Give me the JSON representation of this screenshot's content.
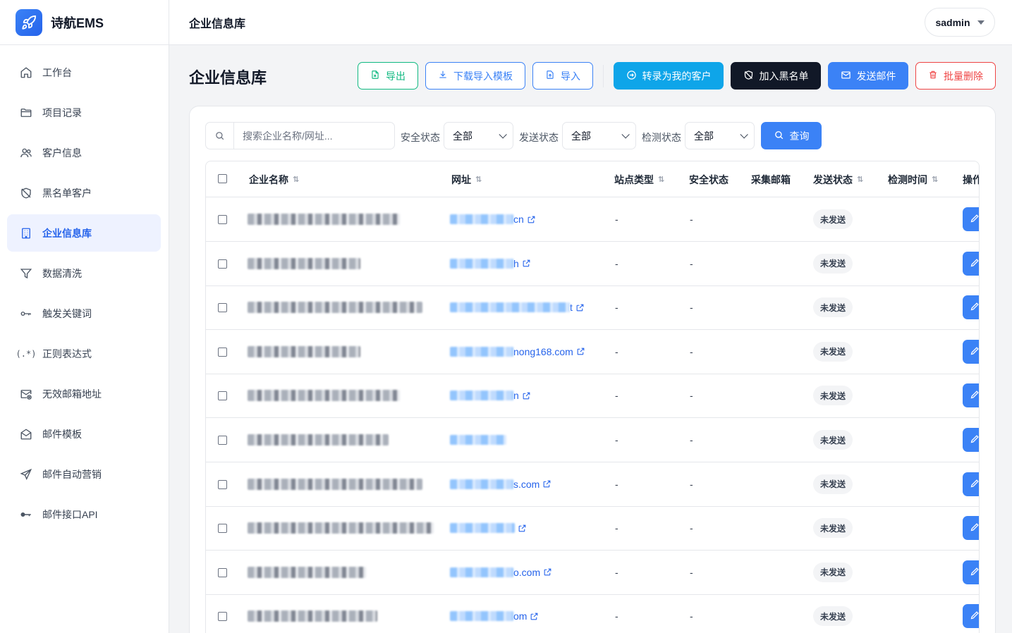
{
  "brand": {
    "name": "诗航EMS"
  },
  "sidebar": {
    "items": [
      {
        "label": "工作台",
        "icon": "home-icon",
        "active": false
      },
      {
        "label": "项目记录",
        "icon": "folder-icon",
        "active": false
      },
      {
        "label": "客户信息",
        "icon": "users-icon",
        "active": false
      },
      {
        "label": "黑名单客户",
        "icon": "shield-off-icon",
        "active": false
      },
      {
        "label": "企业信息库",
        "icon": "building-icon",
        "active": true
      },
      {
        "label": "数据清洗",
        "icon": "filter-icon",
        "active": false
      },
      {
        "label": "触发关键词",
        "icon": "key-icon",
        "active": false
      },
      {
        "label": "正则表达式",
        "icon": "regex-icon",
        "active": false
      },
      {
        "label": "无效邮箱地址",
        "icon": "mail-x-icon",
        "active": false
      },
      {
        "label": "邮件模板",
        "icon": "mail-open-icon",
        "active": false
      },
      {
        "label": "邮件自动营销",
        "icon": "send-icon",
        "active": false
      },
      {
        "label": "邮件接口API",
        "icon": "key-round-icon",
        "active": false
      }
    ]
  },
  "topbar": {
    "title": "企业信息库",
    "user": "sadmin"
  },
  "page": {
    "title": "企业信息库",
    "actions": {
      "export": "导出",
      "download_template": "下载导入模板",
      "import": "导入",
      "convert": "转录为我的客户",
      "blacklist": "加入黑名单",
      "send_mail": "发送邮件",
      "batch_delete": "批量删除"
    }
  },
  "filters": {
    "search_placeholder": "搜索企业名称/网址...",
    "security_label": "安全状态",
    "security_value": "全部",
    "send_label": "发送状态",
    "send_value": "全部",
    "detect_label": "检测状态",
    "detect_value": "全部",
    "query": "查询"
  },
  "table": {
    "headers": {
      "name": "企业名称",
      "url": "网址",
      "site_type": "站点类型",
      "security": "安全状态",
      "collected_email": "采集邮箱",
      "send_status": "发送状态",
      "detect_time": "检测时间",
      "actions": "操作"
    },
    "rows": [
      {
        "url_suffix": "cn",
        "site_type": "-",
        "security": "-",
        "send_status": "未发送"
      },
      {
        "url_suffix": "h",
        "site_type": "-",
        "security": "-",
        "send_status": "未发送"
      },
      {
        "url_suffix": "t",
        "site_type": "-",
        "security": "-",
        "send_status": "未发送"
      },
      {
        "url_suffix": "nong168.com",
        "site_type": "-",
        "security": "-",
        "send_status": "未发送"
      },
      {
        "url_suffix": "n",
        "site_type": "-",
        "security": "-",
        "send_status": "未发送"
      },
      {
        "url_suffix": "",
        "site_type": "-",
        "security": "-",
        "send_status": "未发送"
      },
      {
        "url_suffix": "s.com",
        "site_type": "-",
        "security": "-",
        "send_status": "未发送"
      },
      {
        "url_suffix": "",
        "site_type": "-",
        "security": "-",
        "send_status": "未发送"
      },
      {
        "url_suffix": "o.com",
        "site_type": "-",
        "security": "-",
        "send_status": "未发送"
      },
      {
        "url_suffix": "om",
        "site_type": "-",
        "security": "-",
        "send_status": "未发送"
      }
    ]
  },
  "colors": {
    "primary": "#3b82f6",
    "cyan": "#0ea5e9",
    "dark": "#111827",
    "danger": "#ef4444",
    "success": "#10b981"
  }
}
